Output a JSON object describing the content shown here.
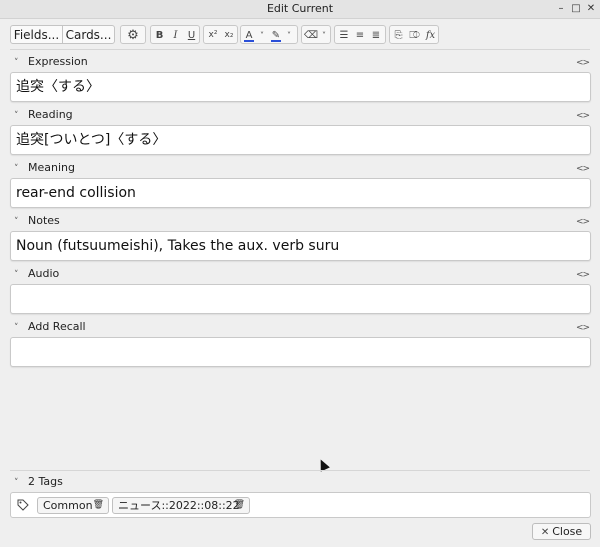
{
  "window": {
    "title": "Edit Current",
    "min_label": "–",
    "max_label": "□",
    "close_label": "✕"
  },
  "toolbar": {
    "fields_label": "Fields...",
    "cards_label": "Cards...",
    "settings_icon": "⚙",
    "bold": "B",
    "italic": "I",
    "underline": "U",
    "superscript": "x²",
    "subscript": "x₂",
    "text_color": "A",
    "highlight": "✎",
    "eraser": "⌫",
    "unordered_list": "☰",
    "ordered_list": "≡",
    "align": "≣",
    "attach": "⎘",
    "record": "⎄",
    "math": "fx",
    "dropdown": "˅",
    "accent_color": "#2a4fd8"
  },
  "fields": [
    {
      "label": "Expression",
      "value": "追突〈する〉"
    },
    {
      "label": "Reading",
      "value": "追突[ついとつ]〈する〉"
    },
    {
      "label": "Meaning",
      "value": "rear-end collision"
    },
    {
      "label": "Notes",
      "value": "Noun (futsuumeishi), Takes the aux. verb suru"
    },
    {
      "label": "Audio",
      "value": ""
    },
    {
      "label": "Add Recall",
      "value": ""
    }
  ],
  "field_toggle": "<>",
  "chevron": "˅",
  "tags": {
    "label": "2 Tags",
    "items": [
      "Common",
      "ニュース::2022::08::22"
    ],
    "delete_icon": "🗑"
  },
  "close_button": {
    "label": "Close"
  }
}
